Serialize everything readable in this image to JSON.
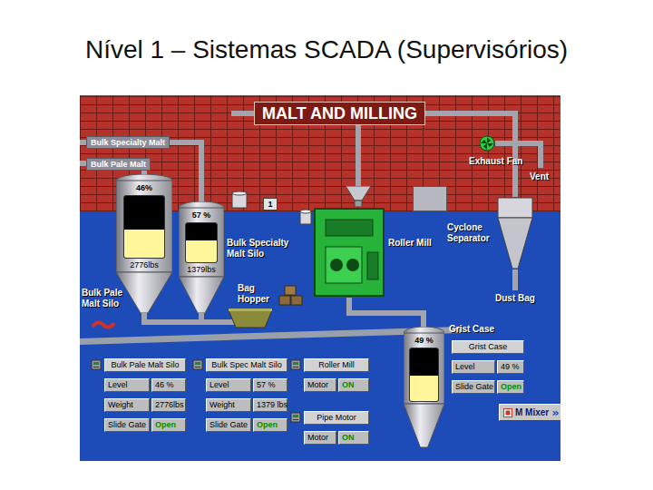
{
  "slide": {
    "title": "Nível 1 – Sistemas SCADA (Supervisórios)"
  },
  "screen": {
    "title": "MALT AND MILLING"
  },
  "pipes": [
    {
      "label": "Bulk Specialty Malt"
    },
    {
      "label": "Bulk Pale Malt"
    }
  ],
  "silos": [
    {
      "label": [
        "Bulk Pale",
        "Malt Silo"
      ],
      "reading": "46%",
      "weight": "2776lbs",
      "level": 0.46
    },
    {
      "label": [
        "Bulk Specialty",
        "Malt Silo"
      ],
      "reading": "57 %",
      "weight": "1379lbs",
      "level": 0.57
    },
    {
      "label": [
        "Grist Case"
      ],
      "reading": "49 %",
      "level": 0.49
    }
  ],
  "equipment": [
    {
      "label": [
        "Roller Mill"
      ]
    },
    {
      "label": [
        "Cyclone",
        "Separator"
      ]
    },
    {
      "label": [
        "Exhaust Fan"
      ]
    },
    {
      "label": [
        "Vent"
      ]
    },
    {
      "label": [
        "Dust Bag"
      ]
    },
    {
      "label": [
        "Bag",
        "Hopper"
      ]
    }
  ],
  "counter": "1",
  "panels": [
    {
      "title": "Bulk Pale Malt Silo",
      "rows": [
        {
          "label": "Level",
          "value": "46 %",
          "kind": "reading"
        },
        {
          "label": "Weight",
          "value": "2776lbs",
          "kind": "reading"
        },
        {
          "label": "Slide Gate",
          "value": "Open",
          "kind": "status",
          "on": true
        }
      ]
    },
    {
      "title": "Bulk Spec Malt Silo",
      "rows": [
        {
          "label": "Level",
          "value": "57 %",
          "kind": "reading"
        },
        {
          "label": "Weight",
          "value": "1379 lbs",
          "kind": "reading"
        },
        {
          "label": "Slide Gate",
          "value": "Open",
          "kind": "status",
          "on": true
        }
      ]
    },
    {
      "title": "Roller Mill",
      "rows": [
        {
          "label": "Motor",
          "value": "ON",
          "kind": "status",
          "on": true
        }
      ]
    },
    {
      "title": "Pipe Motor",
      "rows": [
        {
          "label": "Motor",
          "value": "ON",
          "kind": "status",
          "on": true
        }
      ]
    },
    {
      "title": "Grist Case",
      "rows": [
        {
          "label": "Level",
          "value": "49 %",
          "kind": "reading"
        },
        {
          "label": "Slide Gate",
          "value": "Open",
          "kind": "status",
          "on": true
        }
      ]
    }
  ],
  "mixer_button": {
    "label": "M Mixer",
    "icon": "»"
  }
}
